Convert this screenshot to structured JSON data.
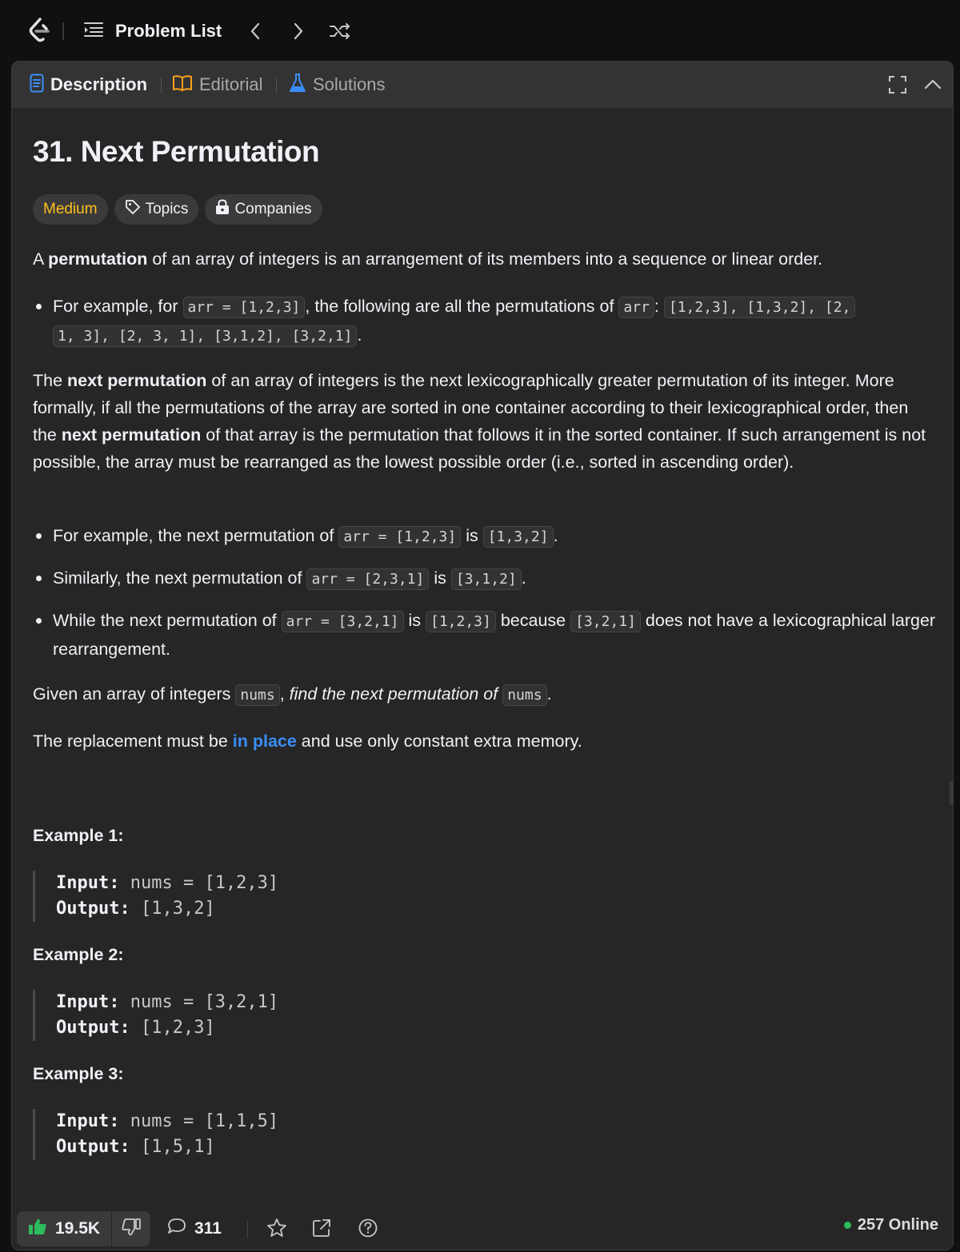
{
  "nav": {
    "problem_list_label": "Problem List"
  },
  "tabs": [
    {
      "label": "Description"
    },
    {
      "label": "Editorial"
    },
    {
      "label": "Solutions"
    }
  ],
  "problem": {
    "title": "31. Next Permutation",
    "difficulty": "Medium",
    "topics_label": "Topics",
    "companies_label": "Companies",
    "p1_a": "A ",
    "p1_b": "permutation",
    "p1_c": " of an array of integers is an arrangement of its members into a sequence or linear order.",
    "b1_a": "For example, for ",
    "b1_code1": "arr = [1,2,3]",
    "b1_b": ", the following are all the permutations of ",
    "b1_code2": "arr",
    "b1_c": ": ",
    "b1_code3": "[1,2,3], [1,3,2], [2,",
    "b1_code4": "1, 3], [2, 3, 1], [3,1,2], [3,2,1]",
    "b1_d": ".",
    "p2_a": "The ",
    "p2_b": "next permutation",
    "p2_c": " of an array of integers is the next lexicographically greater permutation of its integer. More formally, if all the permutations of the array are sorted in one container according to their lexicographical order, then the ",
    "p2_d": "next permutation",
    "p2_e": " of that array is the permutation that follows it in the sorted container. If such arrangement is not possible, the array must be rearranged as the lowest possible order (i.e., sorted in ascending order).",
    "b2_a": "For example, the next permutation of ",
    "b2_code1": "arr = [1,2,3]",
    "b2_b": " is ",
    "b2_code2": "[1,3,2]",
    "b2_c": ".",
    "b3_a": "Similarly, the next permutation of ",
    "b3_code1": "arr = [2,3,1]",
    "b3_b": " is ",
    "b3_code2": "[3,1,2]",
    "b3_c": ".",
    "b4_a": "While the next permutation of ",
    "b4_code1": "arr = [3,2,1]",
    "b4_b": " is ",
    "b4_code2": "[1,2,3]",
    "b4_c": " because ",
    "b4_code3": "[3,2,1]",
    "b4_d": " does not have a lexicographical larger rearrangement.",
    "p3_a": "Given an array of integers ",
    "p3_code1": "nums",
    "p3_b": ", ",
    "p3_c": "find the next permutation of",
    "p3_d": " ",
    "p3_code2": "nums",
    "p3_e": ".",
    "p4_a": "The replacement must be ",
    "p4_link": "in place",
    "p4_b": " and use only constant extra memory."
  },
  "examples": [
    {
      "title": "Example 1:",
      "input_label": "Input:",
      "input": "nums = [1,2,3]",
      "output_label": "Output:",
      "output": "[1,3,2]"
    },
    {
      "title": "Example 2:",
      "input_label": "Input:",
      "input": "nums = [3,2,1]",
      "output_label": "Output:",
      "output": "[1,2,3]"
    },
    {
      "title": "Example 3:",
      "input_label": "Input:",
      "input": "nums = [1,1,5]",
      "output_label": "Output:",
      "output": "[1,5,1]"
    }
  ],
  "footer": {
    "likes": "19.5K",
    "comments": "311",
    "online": "257 Online"
  },
  "colors": {
    "accent_green": "#2cbb5d",
    "difficulty_medium": "#ffc01e",
    "link_blue": "#3b8df6"
  }
}
